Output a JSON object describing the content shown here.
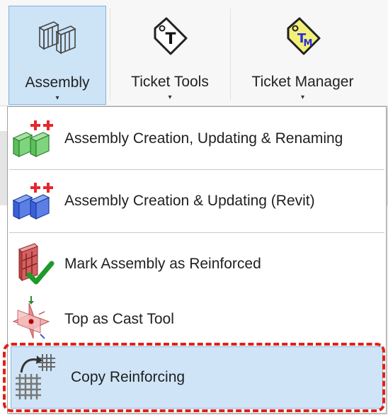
{
  "ribbon": {
    "buttons": [
      {
        "id": "assembly",
        "label": "Assembly",
        "icon": "assembly-boxes-icon",
        "active": true
      },
      {
        "id": "ticket-tools",
        "label": "Ticket Tools",
        "icon": "ticket-tag-t-icon",
        "active": false
      },
      {
        "id": "ticket-manager",
        "label": "Ticket Manager",
        "icon": "ticket-tag-tm-icon",
        "active": false
      }
    ],
    "caret": "▾"
  },
  "menu": {
    "items": [
      {
        "label": "Assembly Creation, Updating & Renaming",
        "icon": "green-assembly-plus-icon"
      },
      {
        "label": "Assembly Creation & Updating (Revit)",
        "icon": "blue-assembly-plus-icon"
      },
      {
        "label": "Mark Assembly as Reinforced",
        "icon": "reinforced-checkmark-icon"
      },
      {
        "label": "Top as Cast Tool",
        "icon": "top-as-cast-icon"
      },
      {
        "label": "Copy Reinforcing",
        "icon": "copy-rebar-icon",
        "highlighted": true
      }
    ]
  },
  "colors": {
    "highlight": "#cfe5f7",
    "highlight_border": "#8ab9e2",
    "annotation_dash": "#e0201a",
    "ticket_manager_tag": "#f3f07a",
    "tm_text": "#2a2ad8",
    "green_plus": "#e8262b"
  }
}
